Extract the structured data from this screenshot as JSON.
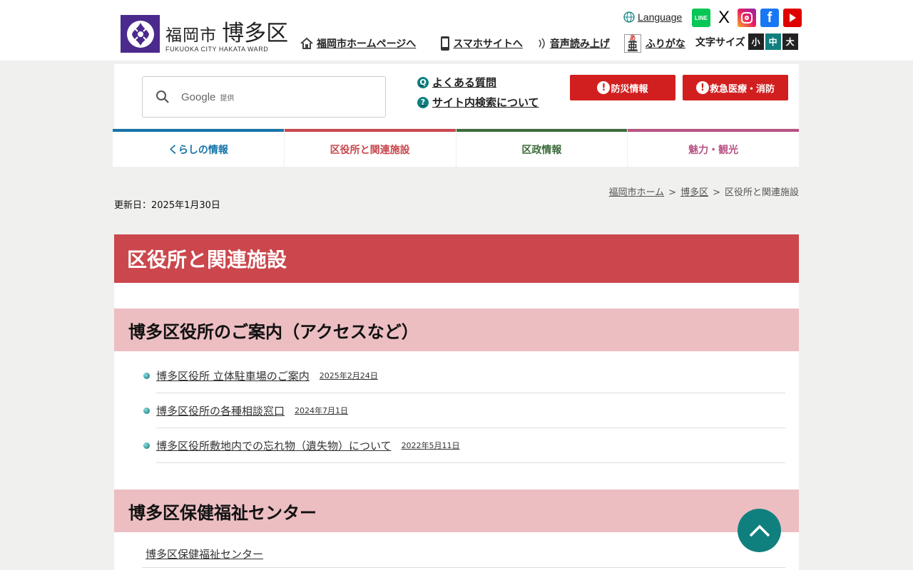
{
  "header": {
    "logo_city": "福岡市",
    "logo_ward": "博多区",
    "logo_en": "FUKUOKA CITY HAKATA WARD",
    "links": {
      "home": "福岡市ホームページへ",
      "smartphone": "スマホサイトへ",
      "voice": "音声読み上げ",
      "furigana": "ふりがな"
    },
    "language": "Language",
    "sns": [
      "line-icon",
      "x-icon",
      "instagram-icon",
      "facebook-icon",
      "youtube-icon"
    ],
    "font_size": {
      "label": "文字サイズ",
      "small": "小",
      "medium": "中",
      "large": "大"
    }
  },
  "search": {
    "google": "Google",
    "provided": "提供"
  },
  "quick_links": {
    "faq": "よくある質問",
    "search_help": "サイト内検索について"
  },
  "emergency": {
    "disaster": "防災情報",
    "medical": "救急医療・消防"
  },
  "nav": [
    {
      "label": "くらしの情報",
      "color": "#1473a8"
    },
    {
      "label": "区役所と関連施設",
      "color": "#c9474d"
    },
    {
      "label": "区政情報",
      "color": "#3c6b3a"
    },
    {
      "label": "魅力・観光",
      "color": "#b85285"
    }
  ],
  "breadcrumb": {
    "home": "福岡市ホーム",
    "ward": "博多区",
    "current": "区役所と関連施設",
    "sep": ">"
  },
  "updated": "更新日：2025年1月30日",
  "page_title": "区役所と関連施設",
  "sections": [
    {
      "heading": "博多区役所のご案内（アクセスなど）",
      "items": [
        {
          "label": "博多区役所 立体駐車場のご案内",
          "date": "2025年2月24日"
        },
        {
          "label": "博多区役所の各種相談窓口",
          "date": "2024年7月1日"
        },
        {
          "label": "博多区役所敷地内での忘れ物（遺失物）について",
          "date": "2022年5月11日"
        }
      ]
    },
    {
      "heading": "博多区保健福祉センター",
      "items": [
        {
          "label": "博多区保健福祉センター"
        }
      ]
    }
  ],
  "colors": {
    "accent_red": "#d11f1f",
    "title_red": "#cb474d",
    "section_pink": "#ecbec2",
    "teal": "#10807f",
    "logo_purple": "#4b2a8c"
  }
}
